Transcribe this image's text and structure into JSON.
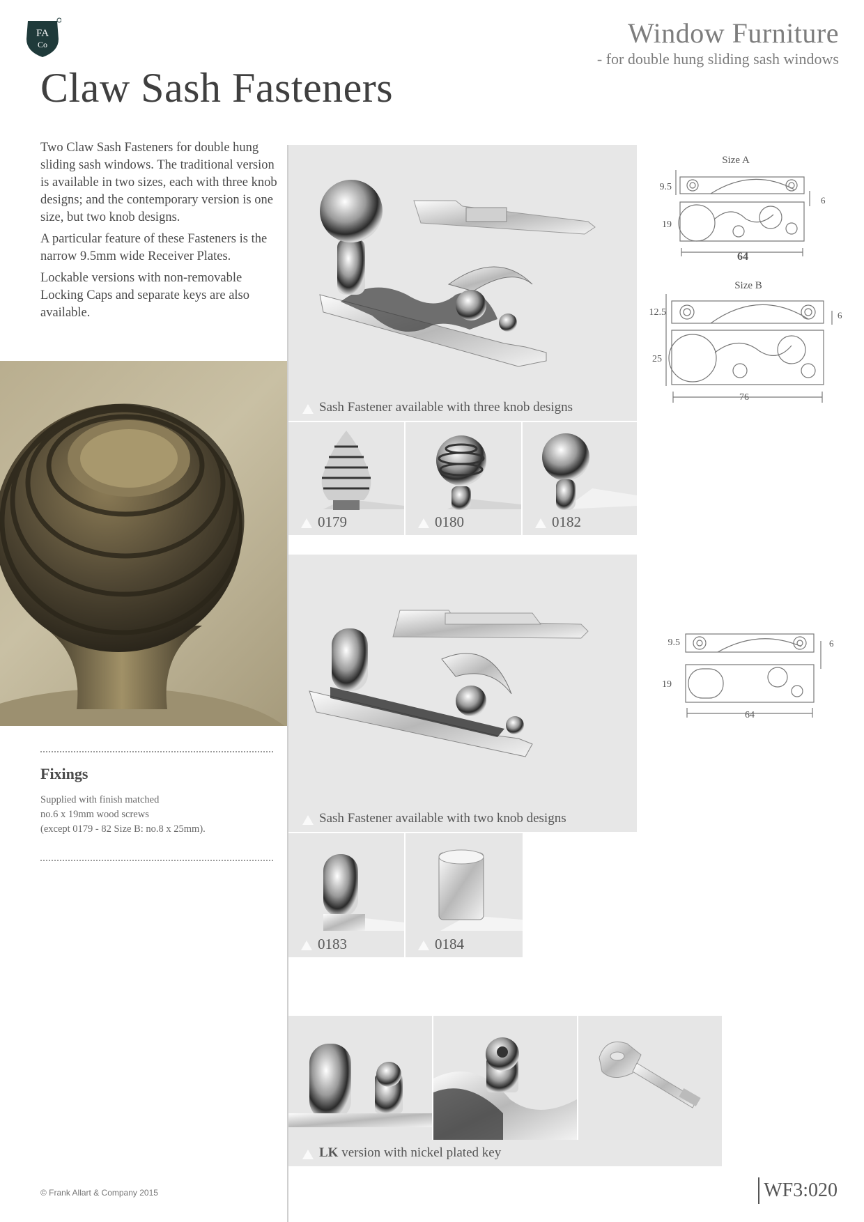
{
  "header": {
    "logo_text": "FA Co",
    "brand_title": "Window Furniture",
    "brand_subtitle": "- for double hung sliding sash windows",
    "page_title": "Claw Sash Fasteners"
  },
  "intro": {
    "p1": "Two Claw Sash Fasteners for double hung sliding sash windows. The traditional version is available in two sizes, each with three knob designs; and the contemporary version is one size, but two knob designs.",
    "p2": "A particular feature of these Fasteners is the narrow 9.5mm wide Receiver Plates.",
    "p3": "Lockable versions with non-removable Locking Caps and separate keys are also available."
  },
  "fixings": {
    "title": "Fixings",
    "line1": "Supplied with finish matched",
    "line2": "no.6 x 19mm wood screws",
    "line3": "(except 0179 - 82 Size B: no.8 x 25mm)."
  },
  "section1": {
    "caption": "Sash Fastener available with three knob designs",
    "thumbs": [
      "0179",
      "0180",
      "0182"
    ]
  },
  "section2": {
    "caption": "Sash Fastener available with two knob designs",
    "thumbs": [
      "0183",
      "0184"
    ]
  },
  "section3": {
    "caption_bold": "LK",
    "caption_rest": " version with nickel plated key"
  },
  "drawings": {
    "size_a": {
      "label": "Size A",
      "w": "9.5",
      "h": "19",
      "len": "64",
      "t": "6"
    },
    "size_b": {
      "label": "Size B",
      "w": "12.5",
      "h": "25",
      "len": "76",
      "t": "6"
    },
    "contemporary": {
      "w": "9.5",
      "h": "19",
      "len": "64",
      "t": "6"
    }
  },
  "footer": {
    "copyright": "© Frank Allart & Company 2015",
    "page_code": "WF3:020"
  }
}
